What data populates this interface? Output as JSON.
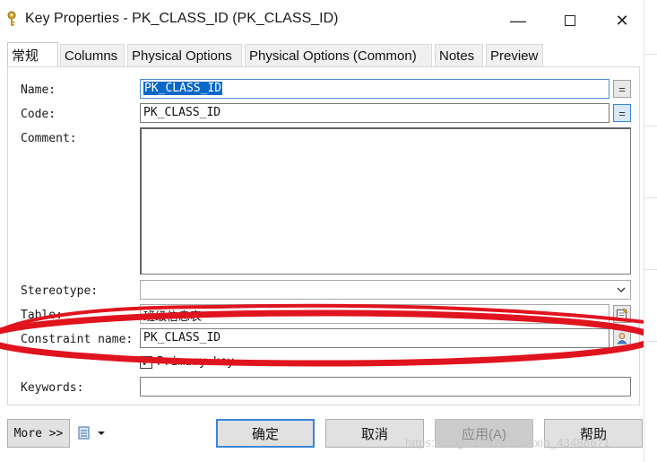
{
  "window": {
    "title": "Key Properties - PK_CLASS_ID (PK_CLASS_ID)",
    "minimize": "—",
    "close": "✕"
  },
  "tabs": [
    {
      "label": "常规",
      "active": true
    },
    {
      "label": "Columns"
    },
    {
      "label": "Physical Options"
    },
    {
      "label": "Physical Options (Common)"
    },
    {
      "label": "Notes"
    },
    {
      "label": "Preview"
    }
  ],
  "form": {
    "name_label": "Name:",
    "name_value": "PK_CLASS_ID",
    "code_label": "Code:",
    "code_value": "PK_CLASS_ID",
    "equals_button": "=",
    "comment_label": "Comment:",
    "comment_value": "",
    "stereotype_label": "Stereotype:",
    "stereotype_value": "",
    "table_label": "Table:",
    "table_value": "班级信息表",
    "constraint_label": "Constraint name:",
    "constraint_value": "PK_CLASS_ID",
    "primary_key_label": "Primary key",
    "primary_key_checked": "✓",
    "keywords_label": "Keywords:",
    "keywords_value": ""
  },
  "footer": {
    "more": "More >>",
    "ok": "确定",
    "cancel": "取消",
    "apply": "应用(A)",
    "help": "帮助"
  },
  "watermark": "https://blog.csdn.net/weixin_43488671",
  "colors": {
    "accent": "#0a68c8",
    "annotation": "#e0141e"
  }
}
